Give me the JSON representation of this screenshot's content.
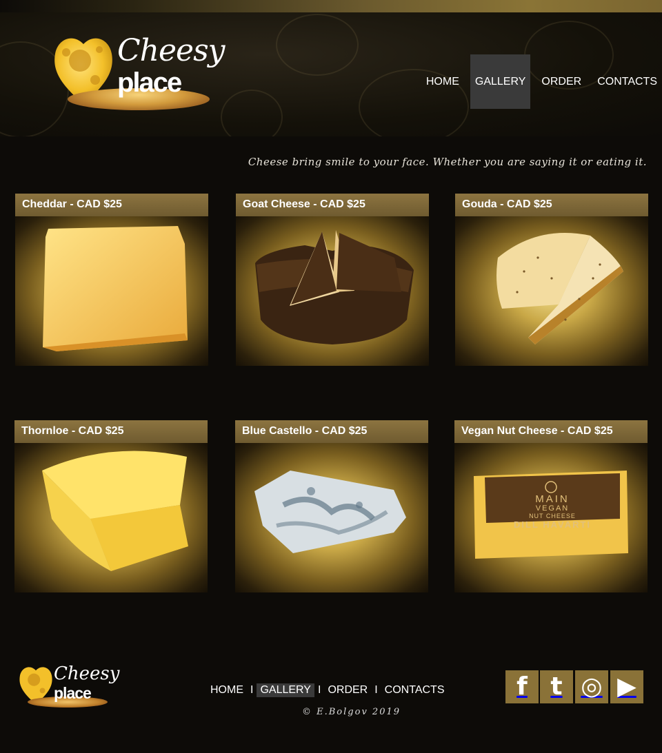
{
  "header": {
    "logo": {
      "script": "Cheesy",
      "bold": "place"
    },
    "nav": [
      {
        "label": "HOME"
      },
      {
        "label": "GALLERY",
        "active": true
      },
      {
        "label": "ORDER"
      },
      {
        "label": "CONTACTS"
      }
    ]
  },
  "tagline": "Cheese bring smile to your face. Whether you are saying it or eating it.",
  "gallery": [
    {
      "title": "Cheddar - CAD $25"
    },
    {
      "title": "Goat Cheese - CAD $25"
    },
    {
      "title": "Gouda - CAD $25"
    },
    {
      "title": "Thornloe  - CAD $25"
    },
    {
      "title": "Blue Castello  - CAD $25"
    },
    {
      "title": "Vegan Nut Cheese - CAD $25"
    }
  ],
  "vegan_label": {
    "line1": "MAIN",
    "line2": "VEGAN",
    "line3": "NUT CHEESE",
    "line4": "DILL HAVARTI"
  },
  "footer": {
    "logo": {
      "script": "Cheesy",
      "bold": "place"
    },
    "nav": [
      {
        "label": "HOME"
      },
      {
        "label": "GALLERY",
        "active": true
      },
      {
        "label": "ORDER"
      },
      {
        "label": "CONTACTS"
      }
    ],
    "separator": "I",
    "copyright": "© E.Bolgov 2019",
    "social": [
      {
        "icon": "facebook-icon",
        "glyph": "f"
      },
      {
        "icon": "twitter-icon",
        "glyph": "t"
      },
      {
        "icon": "instagram-icon",
        "glyph": "◎"
      },
      {
        "icon": "youtube-icon",
        "glyph": "▶"
      }
    ]
  },
  "colors": {
    "accent": "#8a7238",
    "background": "#0d0b08",
    "nav_active": "#3a3a3a"
  }
}
